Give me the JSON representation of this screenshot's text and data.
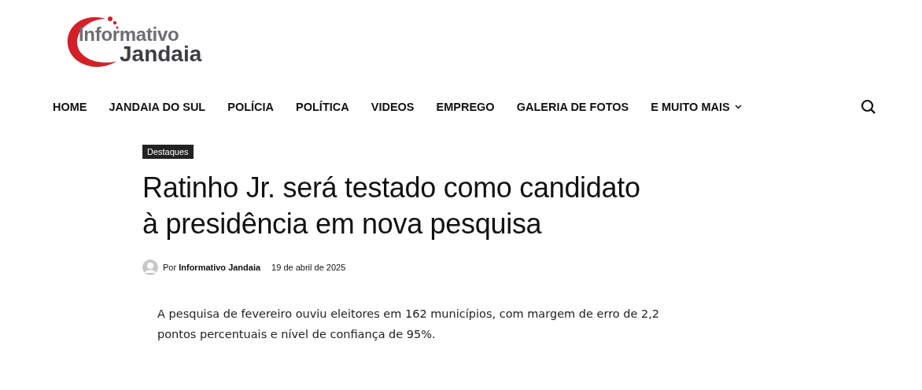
{
  "logo": {
    "line_1": "Informativo",
    "line_2": "Jandaia"
  },
  "nav": [
    {
      "label": "HOME",
      "kind": "link"
    },
    {
      "label": "JANDAIA DO SUL",
      "kind": "link"
    },
    {
      "label": "POLÍCIA",
      "kind": "link"
    },
    {
      "label": "POLÍTICA",
      "kind": "link"
    },
    {
      "label": "VIDEOS",
      "kind": "link"
    },
    {
      "label": "EMPREGO",
      "kind": "link"
    },
    {
      "label": "GALERIA DE FOTOS",
      "kind": "link"
    },
    {
      "label": "E MUITO MAIS",
      "kind": "dropdown"
    }
  ],
  "article": {
    "category": "Destaques",
    "title_lines": [
      "Ratinho Jr. será testado como candidato",
      "à presidência em nova pesquisa"
    ],
    "by": "Por",
    "author": "Informativo Jandaia",
    "date": "19 de abril de 2025",
    "summary": [
      "A pesquisa de fevereiro ouviu eleitores em 162 municípios, com margem de erro de 2,2",
      "pontos percentuais e nível de confiança de 95%."
    ]
  }
}
